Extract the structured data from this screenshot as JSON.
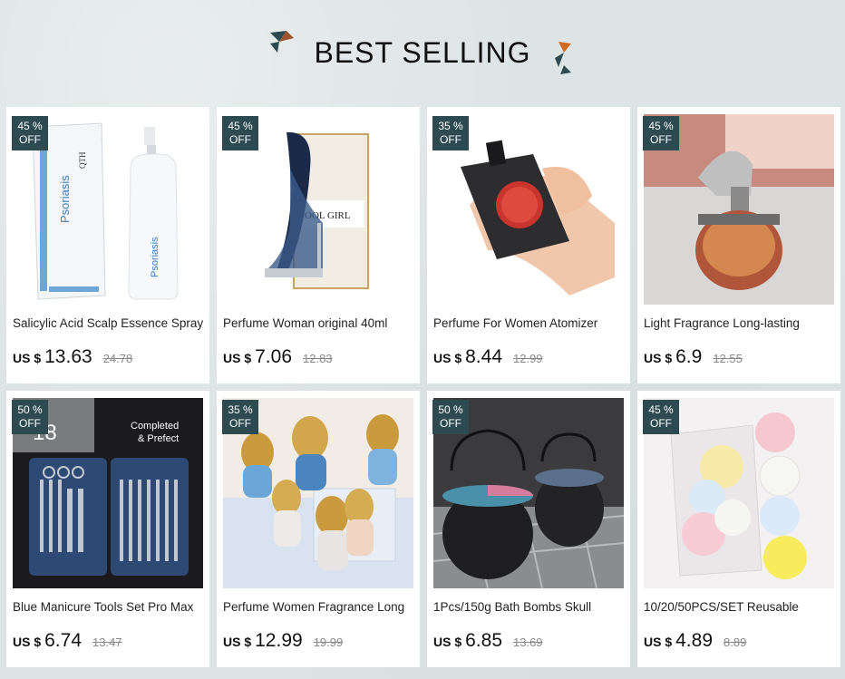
{
  "section": {
    "title": "BEST SELLING"
  },
  "products": [
    {
      "name": "Salicylic Acid Scalp Essence Spray",
      "discount": "45 %",
      "off": "OFF",
      "currency": "US $",
      "price": "13.63",
      "old_price": "24.78",
      "img_text_1": "QTH",
      "img_text_2": "Psoriasis"
    },
    {
      "name": "Perfume Woman original 40ml",
      "discount": "45 %",
      "off": "OFF",
      "currency": "US $",
      "price": "7.06",
      "old_price": "12.83",
      "img_text_1": "OOL GIRL"
    },
    {
      "name": "Perfume For Women Atomizer",
      "discount": "35 %",
      "off": "OFF",
      "currency": "US $",
      "price": "8.44",
      "old_price": "12.99"
    },
    {
      "name": "Light Fragrance Long-lasting",
      "discount": "45 %",
      "off": "OFF",
      "currency": "US $",
      "price": "6.9",
      "old_price": "12.55"
    },
    {
      "name": "Blue Manicure Tools Set Pro Max",
      "discount": "50 %",
      "off": "OFF",
      "currency": "US $",
      "price": "6.74",
      "old_price": "13.47",
      "img_text_1": "Completed",
      "img_text_2": "& Prefect",
      "img_text_3": "18"
    },
    {
      "name": "Perfume Women Fragrance Long",
      "discount": "35 %",
      "off": "OFF",
      "currency": "US $",
      "price": "12.99",
      "old_price": "19.99"
    },
    {
      "name": "1Pcs/150g Bath Bombs Skull",
      "discount": "50 %",
      "off": "OFF",
      "currency": "US $",
      "price": "6.85",
      "old_price": "13.69"
    },
    {
      "name": "10/20/50PCS/SET Reusable",
      "discount": "45 %",
      "off": "OFF",
      "currency": "US $",
      "price": "4.89",
      "old_price": "8.89"
    }
  ],
  "colors": {
    "badge_bg": "#2e4a51",
    "page_bg": "#dde4e5"
  }
}
